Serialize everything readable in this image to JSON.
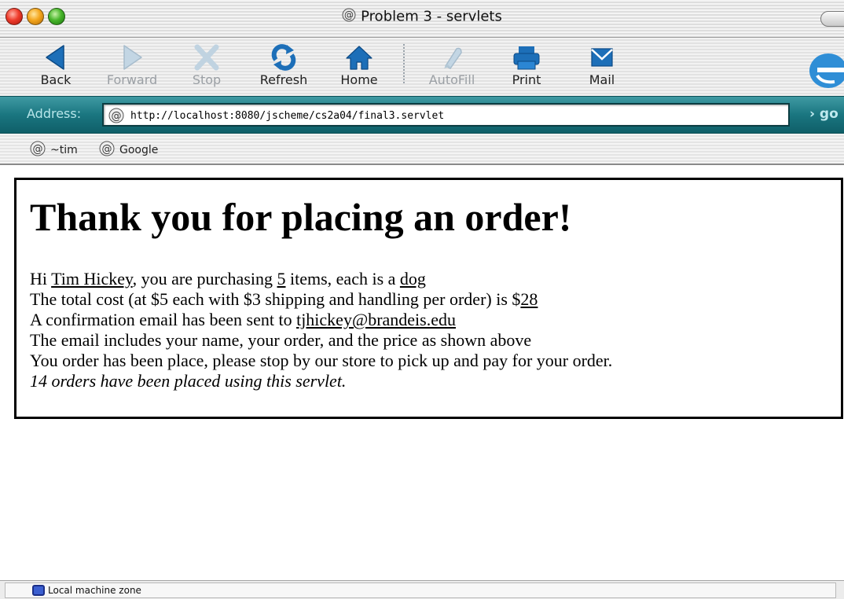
{
  "window": {
    "title": "Problem 3 - servlets"
  },
  "toolbar": {
    "buttons": [
      {
        "label": "Back",
        "icon": "back-arrow-icon",
        "enabled": true
      },
      {
        "label": "Forward",
        "icon": "forward-arrow-icon",
        "enabled": false
      },
      {
        "label": "Stop",
        "icon": "stop-x-icon",
        "enabled": false
      },
      {
        "label": "Refresh",
        "icon": "refresh-icon",
        "enabled": true
      },
      {
        "label": "Home",
        "icon": "home-icon",
        "enabled": true
      },
      {
        "label": "AutoFill",
        "icon": "autofill-icon",
        "enabled": false
      },
      {
        "label": "Print",
        "icon": "print-icon",
        "enabled": true
      },
      {
        "label": "Mail",
        "icon": "mail-icon",
        "enabled": true
      }
    ]
  },
  "address_bar": {
    "label": "Address:",
    "url": "http://localhost:8080/jscheme/cs2a04/final3.servlet",
    "go_label": "› go"
  },
  "favorites": [
    {
      "label": "~tim"
    },
    {
      "label": "Google"
    }
  ],
  "page": {
    "heading": "Thank you for placing an order!",
    "line1": {
      "prefix": "Hi ",
      "name": "Tim Hickey",
      "middle": ", you are purchasing ",
      "quantity": "5",
      "middle2": " items, each is a ",
      "item": "dog"
    },
    "line2": {
      "prefix": "The total cost (at $5 each with $3 shipping and handling per order) is $",
      "total": "28"
    },
    "line3": {
      "prefix": "A confirmation email has been sent to ",
      "email": "tjhickey@brandeis.edu"
    },
    "line4": "The email includes your name, your order, and the price as shown above",
    "line5": "You order has been place, please stop by our store to pick up and pay for your order.",
    "line6": "14 orders have been placed using this servlet."
  },
  "status_bar": {
    "zone": "Local machine zone"
  },
  "colors": {
    "address_bar": "#1a7680",
    "enabled_icon": "#1d6fb8",
    "disabled_icon": "#b9cbd8"
  }
}
